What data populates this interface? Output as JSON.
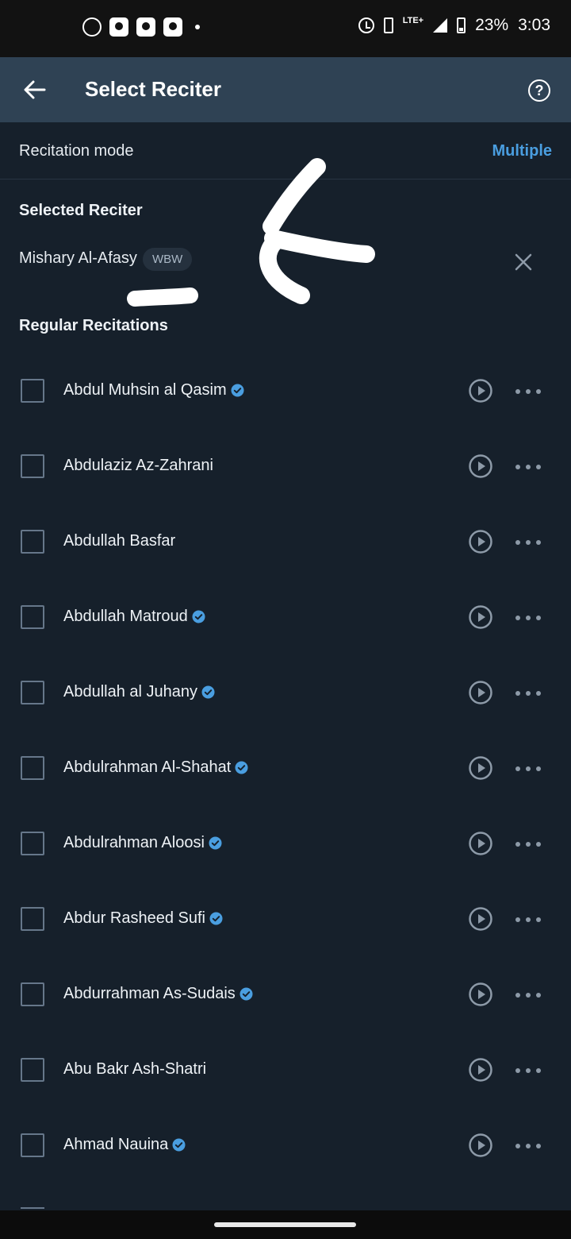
{
  "status_bar": {
    "lte": "LTE+",
    "battery": "23%",
    "time": "3:03"
  },
  "app_bar": {
    "title": "Select Reciter",
    "back_icon": "arrow-left-icon",
    "help_icon": "question-circle-icon",
    "help_glyph": "?"
  },
  "recitation_mode": {
    "label": "Recitation mode",
    "value": "Multiple"
  },
  "selected_section": {
    "heading": "Selected Reciter",
    "name": "Mishary Al-Afasy",
    "badge": "WBW"
  },
  "regular_section": {
    "heading": "Regular Recitations"
  },
  "reciters": [
    {
      "name": "Abdul Muhsin al Qasim",
      "verified": true
    },
    {
      "name": "Abdulaziz Az-Zahrani",
      "verified": false
    },
    {
      "name": "Abdullah Basfar",
      "verified": false
    },
    {
      "name": "Abdullah Matroud",
      "verified": true
    },
    {
      "name": "Abdullah al Juhany",
      "verified": true
    },
    {
      "name": "Abdulrahman Al-Shahat",
      "verified": true
    },
    {
      "name": "Abdulrahman Aloosi",
      "verified": true
    },
    {
      "name": "Abdur Rasheed Sufi",
      "verified": true
    },
    {
      "name": "Abdurrahman As-Sudais",
      "verified": true
    },
    {
      "name": "Abu Bakr Ash-Shatri",
      "verified": false
    },
    {
      "name": "Ahmad Nauina",
      "verified": true
    }
  ],
  "colors": {
    "background": "#16202b",
    "app_bar": "#2f4254",
    "accent": "#4a9ee0",
    "verified": "#4a9ee0"
  }
}
